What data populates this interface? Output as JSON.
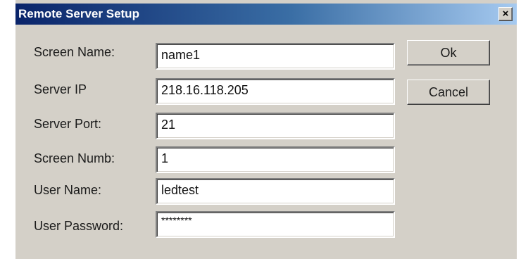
{
  "window": {
    "title": "Remote Server Setup",
    "close_label": "×"
  },
  "fields": [
    {
      "label": "Screen Name:",
      "value": "name1"
    },
    {
      "label": "Server IP",
      "value": "218.16.118.205"
    },
    {
      "label": "Server Port:",
      "value": "21"
    },
    {
      "label": "Screen Numb:",
      "value": "1"
    },
    {
      "label": "User Name:",
      "value": "ledtest"
    },
    {
      "label": "User Password:",
      "value": "********"
    }
  ],
  "buttons": {
    "ok_label": "Ok",
    "cancel_label": "Cancel"
  },
  "colors": {
    "title_bar_start": "#0a246a",
    "title_bar_end": "#a6caf0",
    "dialog_bg": "#d4d0c8"
  }
}
